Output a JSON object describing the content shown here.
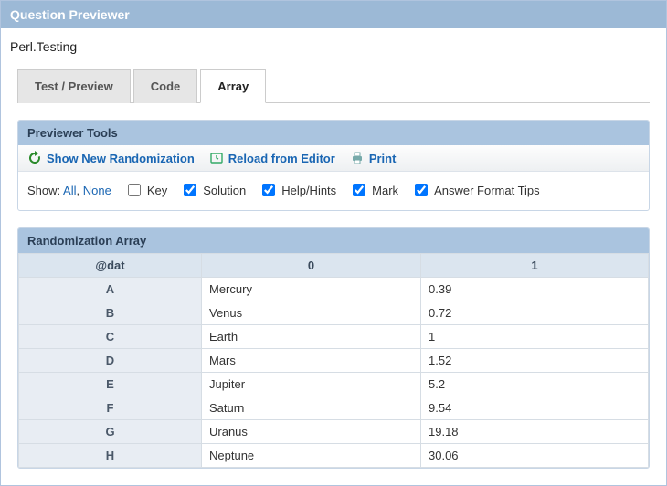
{
  "window": {
    "title": "Question Previewer"
  },
  "subtitle": "Perl.Testing",
  "tabs": [
    {
      "label": "Test / Preview",
      "active": false
    },
    {
      "label": "Code",
      "active": false
    },
    {
      "label": "Array",
      "active": true
    }
  ],
  "previewer_tools": {
    "header": "Previewer Tools",
    "actions": {
      "randomize": "Show New Randomization",
      "reload": "Reload from Editor",
      "print": "Print"
    },
    "show_label": "Show:",
    "all": "All",
    "none": "None",
    "options": {
      "key": {
        "label": "Key",
        "checked": false
      },
      "solution": {
        "label": "Solution",
        "checked": true
      },
      "help": {
        "label": "Help/Hints",
        "checked": true
      },
      "mark": {
        "label": "Mark",
        "checked": true
      },
      "tips": {
        "label": "Answer Format Tips",
        "checked": true
      }
    }
  },
  "rand_array": {
    "header": "Randomization Array",
    "var": "@dat",
    "cols": [
      "0",
      "1"
    ],
    "rows": [
      {
        "r": "A",
        "c0": "Mercury",
        "c1": "0.39"
      },
      {
        "r": "B",
        "c0": "Venus",
        "c1": "0.72"
      },
      {
        "r": "C",
        "c0": "Earth",
        "c1": "1"
      },
      {
        "r": "D",
        "c0": "Mars",
        "c1": "1.52"
      },
      {
        "r": "E",
        "c0": "Jupiter",
        "c1": "5.2"
      },
      {
        "r": "F",
        "c0": "Saturn",
        "c1": "9.54"
      },
      {
        "r": "G",
        "c0": "Uranus",
        "c1": "19.18"
      },
      {
        "r": "H",
        "c0": "Neptune",
        "c1": "30.06"
      }
    ]
  }
}
